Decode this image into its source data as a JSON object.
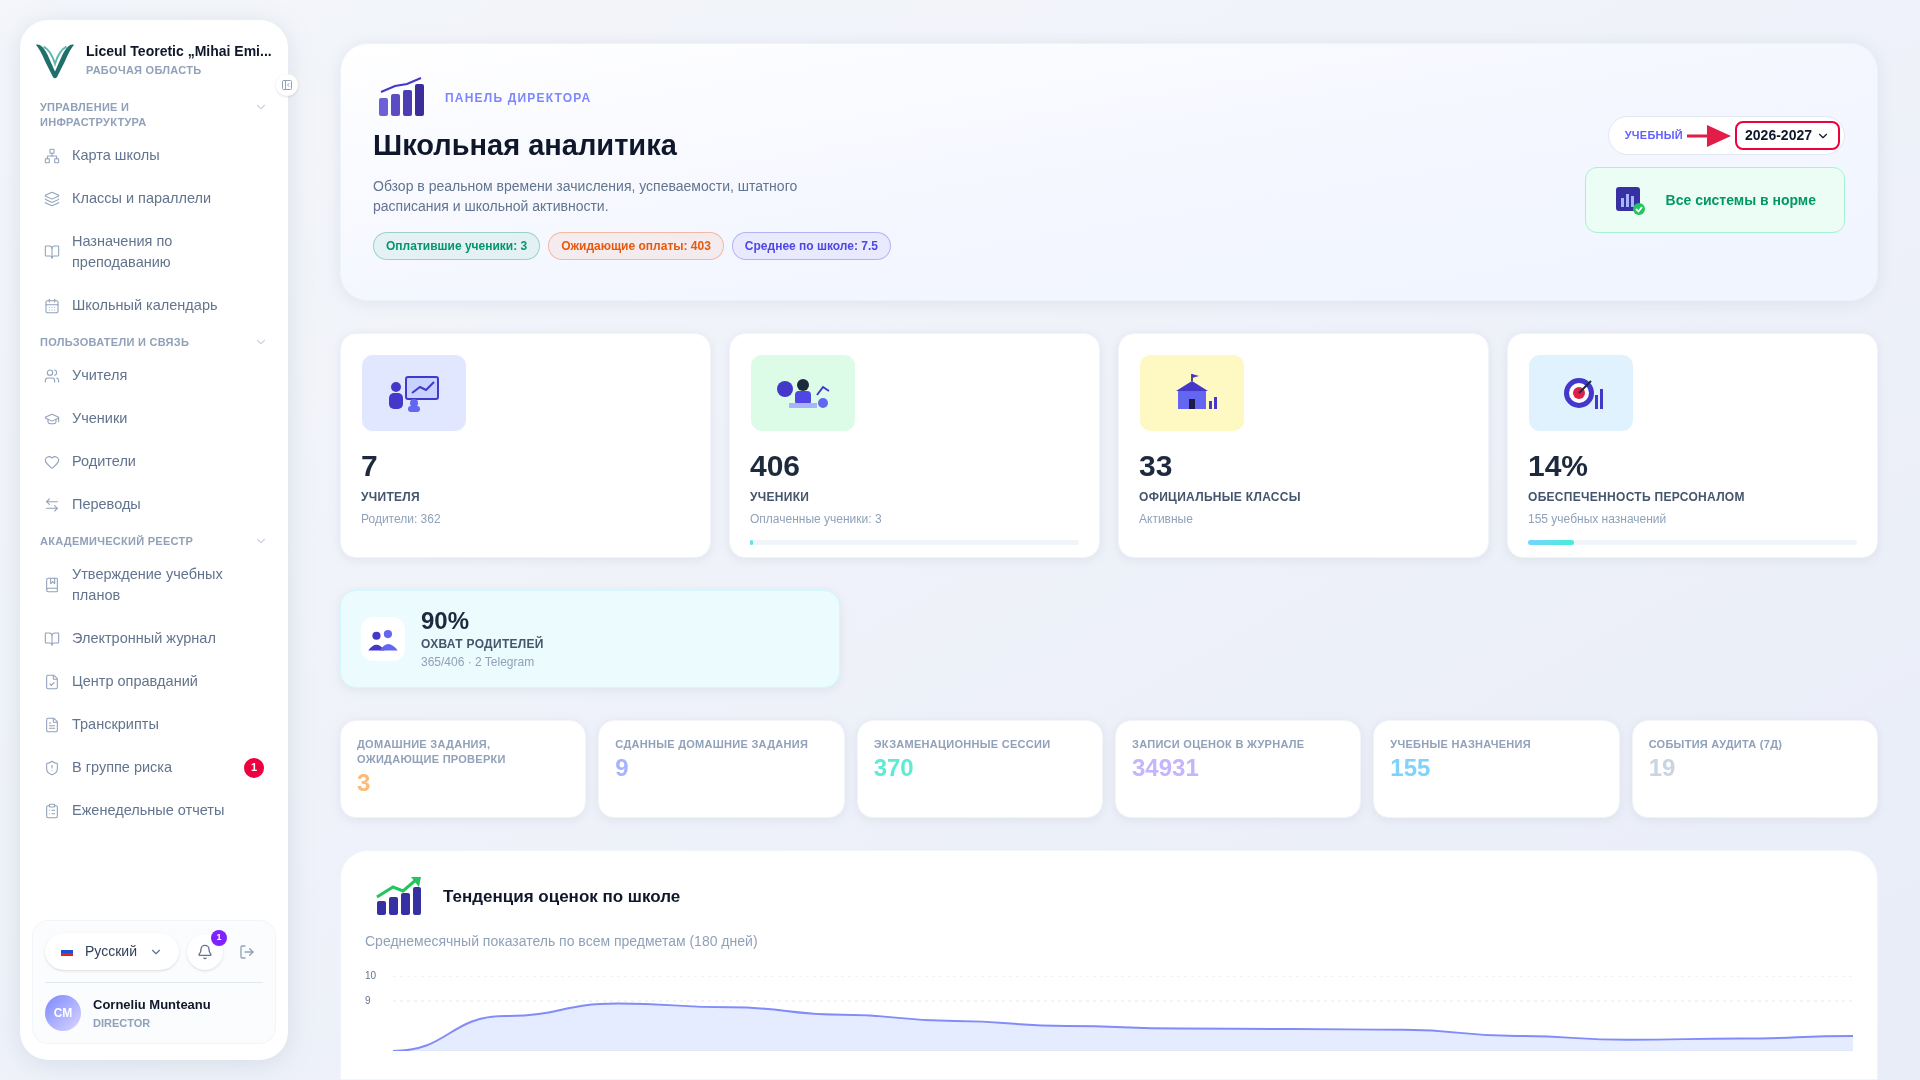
{
  "sidebar": {
    "school": "Liceul Teoretic „Mihai Emi...",
    "workspace": "РАБОЧАЯ ОБЛАСТЬ",
    "sections": [
      {
        "title": "УПРАВЛЕНИЕ И ИНФРАСТРУКТУРА",
        "expanded": true,
        "items": [
          {
            "label": "Карта школы",
            "kind": "sitemap"
          },
          {
            "label": "Классы и параллели",
            "kind": "layers"
          },
          {
            "label": "Назначения по преподаванию",
            "kind": "book"
          },
          {
            "label": "Школьный календарь",
            "kind": "calendar"
          }
        ]
      },
      {
        "title": "ПОЛЬЗОВАТЕЛИ И СВЯЗЬ",
        "expanded": true,
        "items": [
          {
            "label": "Учителя",
            "kind": "users"
          },
          {
            "label": "Ученики",
            "kind": "cap"
          },
          {
            "label": "Родители",
            "kind": "heart"
          },
          {
            "label": "Переводы",
            "kind": "arrows"
          }
        ]
      },
      {
        "title": "АКАДЕМИЧЕСКИЙ РЕЕСТР",
        "expanded": true,
        "items": [
          {
            "label": "Утверждение учебных планов",
            "kind": "bookmark"
          },
          {
            "label": "Электронный журнал",
            "kind": "book"
          },
          {
            "label": "Центр оправданий",
            "kind": "filecheck"
          },
          {
            "label": "Транскрипты",
            "kind": "file"
          },
          {
            "label": "В группе риска",
            "kind": "shield",
            "badge": "1"
          },
          {
            "label": "Еженедельные отчеты",
            "kind": "clipboard"
          }
        ]
      }
    ],
    "language": "Русский",
    "notifications": "1",
    "user": {
      "initials": "CM",
      "name": "Corneliu Munteanu",
      "role": "DIRECTOR"
    }
  },
  "header": {
    "eyebrow": "ПАНЕЛЬ ДИРЕКТОРА",
    "title": "Школьная аналитика",
    "description": "Обзор в реальном времени зачисления, успеваемости, штатного расписания и школьной активности.",
    "tags": [
      {
        "label": "Оплатившие ученики: 3",
        "color": "#059669"
      },
      {
        "label": "Ожидающие оплаты: 403",
        "color": "#ea580c"
      },
      {
        "label": "Среднее по школе: 7.5",
        "color": "#4f46e5"
      }
    ],
    "year_label": "УЧЕБНЫЙ",
    "year": "2026-2027",
    "status": "Все системы в норме"
  },
  "cards": [
    {
      "value": "7",
      "label": "УЧИТЕЛЯ",
      "sub": "Родители: 362",
      "kind": "teachers",
      "color": "#e0e7ff"
    },
    {
      "value": "406",
      "label": "УЧЕНИКИ",
      "sub": "Оплаченные ученики: 3",
      "kind": "students",
      "color": "#dcfce7",
      "level": 0.01
    },
    {
      "value": "33",
      "label": "ОФИЦИАЛЬНЫЕ КЛАССЫ",
      "sub": "Активные",
      "kind": "school",
      "color": "#fef9c3"
    },
    {
      "value": "14%",
      "label": "ОБЕСПЕЧЕННОСТЬ ПЕРСОНАЛОМ",
      "sub": "155 учебных назначений",
      "kind": "target",
      "color": "#e0f2fe",
      "level": 0.14
    }
  ],
  "coverage": {
    "value": "90%",
    "label": "ОХВАТ РОДИТЕЛЕЙ",
    "sub": "365/406 · 2 Telegram"
  },
  "stats": [
    {
      "label": "ДОМАШНИЕ ЗАДАНИЯ, ОЖИДАЮЩИЕ ПРОВЕРКИ",
      "value": "3",
      "color": "#fdba74"
    },
    {
      "label": "СДАННЫЕ ДОМАШНИЕ ЗАДАНИЯ",
      "value": "9",
      "color": "#a5b4fc"
    },
    {
      "label": "ЭКЗАМЕНАЦИОННЫЕ СЕССИИ",
      "value": "370",
      "color": "#5eead4"
    },
    {
      "label": "ЗАПИСИ ОЦЕНОК В ЖУРНАЛЕ",
      "value": "34931",
      "color": "#c4b5fd"
    },
    {
      "label": "УЧЕБНЫЕ НАЗНАЧЕНИЯ",
      "value": "155",
      "color": "#7dd3fc"
    },
    {
      "label": "СОБЫТИЯ АУДИТА (7Д)",
      "value": "19",
      "color": "#cbd5e1"
    }
  ],
  "trend": {
    "title": "Тенденция оценок по школе",
    "subtitle": "Среднемесячный показатель по всем предметам (180 дней)",
    "chart_data": {
      "type": "area",
      "ylim": [
        7,
        10
      ],
      "yticks": [
        9,
        10
      ],
      "series": [
        {
          "color": "#818cf8",
          "values": [
            7.0,
            8.4,
            8.9,
            8.75,
            8.45,
            8.2,
            8.0,
            7.9,
            7.88,
            7.85,
            7.6,
            7.45,
            7.5,
            7.6
          ]
        }
      ]
    }
  }
}
